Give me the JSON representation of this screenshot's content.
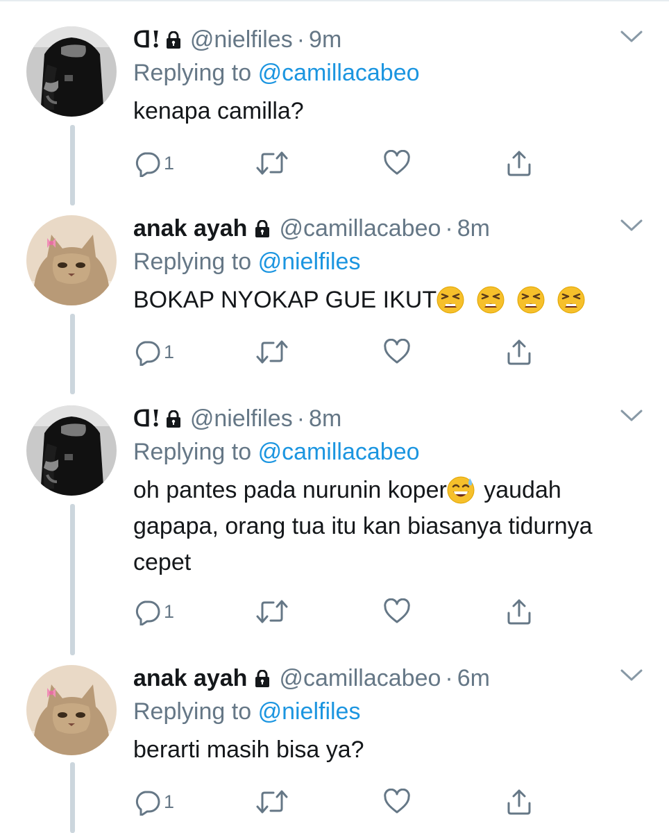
{
  "colors": {
    "link": "#1b95e0",
    "muted": "#657786",
    "text": "#14171a",
    "thread_line": "#ccd6dd"
  },
  "tweets": [
    {
      "display_name": "ᗡ!",
      "handle": "@nielfiles",
      "separator": "·",
      "time": "9m",
      "replying_label": "Replying to",
      "replying_to": "@camillacabeo",
      "text": "kenapa camilla?",
      "reply_count": "1",
      "avatar_icon": "person-black-outfit-avatar"
    },
    {
      "display_name": "anak ayah",
      "handle": "@camillacabeo",
      "separator": "·",
      "time": "8m",
      "replying_label": "Replying to",
      "replying_to": "@nielfiles",
      "text": "BOKAP NYOKAP GUE IKUT",
      "text_emoji": "tired-face-emoji x4",
      "reply_count": "1",
      "avatar_icon": "cat-with-bow-avatar"
    },
    {
      "display_name": "ᗡ!",
      "handle": "@nielfiles",
      "separator": "·",
      "time": "8m",
      "replying_label": "Replying to",
      "replying_to": "@camillacabeo",
      "text_before": "oh pantes pada nurunin koper",
      "text_emoji": "sweat-smile-emoji",
      "text_after": " yaudah gapapa, orang tua itu kan biasanya tidurnya cepet",
      "reply_count": "1",
      "avatar_icon": "person-black-outfit-avatar"
    },
    {
      "display_name": "anak ayah",
      "handle": "@camillacabeo",
      "separator": "·",
      "time": "6m",
      "replying_label": "Replying to",
      "replying_to": "@nielfiles",
      "text": "berarti masih bisa ya?",
      "reply_count": "1",
      "avatar_icon": "cat-with-bow-avatar"
    }
  ]
}
